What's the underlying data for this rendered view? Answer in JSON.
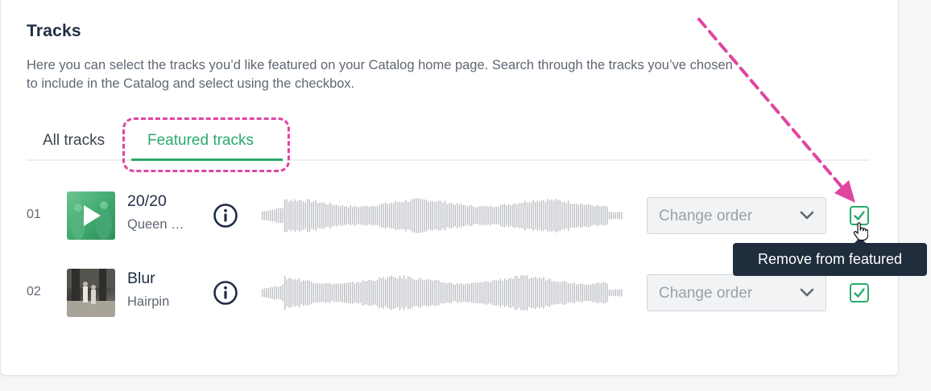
{
  "section": {
    "title": "Tracks",
    "description": "Here you can select the tracks you’d like featured on your Catalog home page. Search through the tracks you’ve chosen to include in the Catalog and select using the checkbox."
  },
  "tabs": [
    {
      "label": "All tracks",
      "active": false
    },
    {
      "label": "Featured tracks",
      "active": true
    }
  ],
  "tracks": [
    {
      "number": "01",
      "title": "20/20",
      "artist": "Queen …",
      "order_placeholder": "Change order",
      "featured": true,
      "cover_icon": "play-icon"
    },
    {
      "number": "02",
      "title": "Blur",
      "artist": "Hairpin",
      "order_placeholder": "Change order",
      "featured": true,
      "cover_icon": "photo"
    }
  ],
  "tooltip": {
    "text": "Remove from featured"
  },
  "icons": {
    "info": "info-circle-icon",
    "chevron": "chevron-down-icon",
    "check": "check-icon",
    "cursor": "hand-pointer-icon"
  },
  "colors": {
    "accent": "#2aaa6a",
    "annotation": "#e0459f",
    "heading": "#1f2d44",
    "tooltip_bg": "#1f2d3d"
  }
}
